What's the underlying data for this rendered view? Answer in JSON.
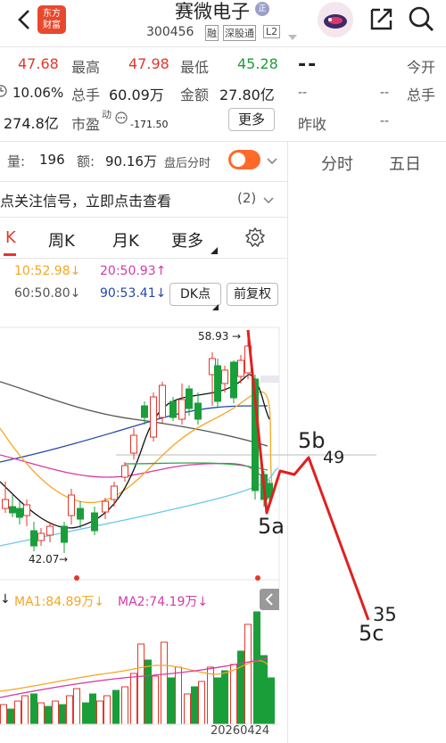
{
  "header": {
    "app_logo_line1": "东方",
    "app_logo_line2": "财富",
    "stock_name": "赛微电子",
    "stock_code": "300456",
    "tag_rong": "融",
    "tag_sgt": "深股通",
    "tag_level": "L2",
    "badge_zheng": "正"
  },
  "quote": {
    "price_prev": "47.68",
    "high_label": "最高",
    "high_value": "47.98",
    "low_label": "最低",
    "low_value": "45.28",
    "turnover_rate": "10.06%",
    "volume_label": "总手",
    "volume_value": "60.09万",
    "amount_label": "金额",
    "amount_value": "27.80亿",
    "market_cap": "274.8亿",
    "pe_label": "市盈",
    "pe_sup": "动",
    "pe_value": "-171.50",
    "more_button": "更多"
  },
  "right_panel": {
    "price": "--",
    "today_open_label": "今开",
    "dash1": "--",
    "dash2": "--",
    "volume_label": "总手",
    "prev_close_label": "昨收",
    "dash3": "--",
    "tab_minute": "分时",
    "tab_fiveday": "五日"
  },
  "trade_bar": {
    "volume_label": "量:",
    "volume_value": "196",
    "amount_label": "额:",
    "amount_value": "90.16万",
    "after_hours_label": "盘后分时"
  },
  "signal_bar": {
    "text": "点关注信号，立即点击查看",
    "count": "(2)"
  },
  "chart_tabs": [
    "K",
    "周K",
    "月K",
    "更多"
  ],
  "ma_legend": {
    "ma10": "10:52.98",
    "ma20": "20:50.93",
    "ma60": "60:50.80",
    "ma90": "90:53.41",
    "dk_button": "DK点",
    "fq_button": "前复权"
  },
  "chart_labels": {
    "high_marker": "58.93",
    "low_marker": "42.07",
    "wave_5a": "5a",
    "wave_5b": "5b",
    "wave_5b_value": "49",
    "wave_5c": "5c",
    "wave_5c_value": "35"
  },
  "volume_legend": {
    "ma1": "MA1:84.89万",
    "ma2": "MA2:74.19万"
  },
  "date_label": "20260424",
  "colors": {
    "up": "#e4372b",
    "down": "#1a9e3a",
    "accent": "#ff6a2a",
    "ma10": "#f5a623",
    "ma20": "#d63aa9",
    "ma60": "#555555",
    "ma90": "#2847a8"
  }
}
